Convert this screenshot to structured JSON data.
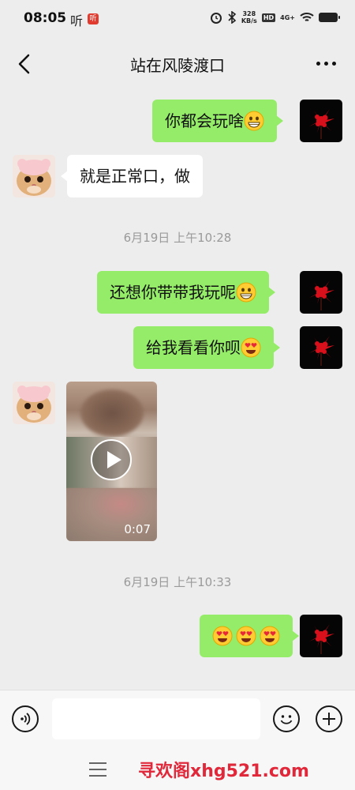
{
  "status_bar": {
    "time": "08:05",
    "listen_label": "听",
    "listen_badge": "听",
    "net_speed_value": "328",
    "net_speed_unit": "KB/s",
    "hd_label": "HD",
    "signal_label": "4G+"
  },
  "header": {
    "title": "站在风陵渡口"
  },
  "messages": [
    {
      "side": "me",
      "text": "你都会玩啥",
      "emoji": "grinning-face-icon"
    },
    {
      "side": "other",
      "text": "就是正常口，做"
    },
    {
      "type": "timestamp",
      "text": "6月19日 上午10:28"
    },
    {
      "side": "me",
      "text": "还想你带带我玩呢",
      "emoji": "grinning-face-icon"
    },
    {
      "side": "me",
      "text": "给我看看你呗",
      "emoji": "heart-eyes-icon"
    },
    {
      "side": "other",
      "type": "video",
      "duration": "0:07"
    },
    {
      "type": "timestamp",
      "text": "6月19日 上午10:33"
    },
    {
      "side": "me",
      "emoji_only": [
        "heart-eyes-icon",
        "heart-eyes-icon",
        "heart-eyes-icon"
      ]
    }
  ],
  "watermark": "寻欢阁xhg521.com",
  "colors": {
    "my_bubble": "#95ec69",
    "other_bubble": "#ffffff",
    "background": "#ededed"
  }
}
